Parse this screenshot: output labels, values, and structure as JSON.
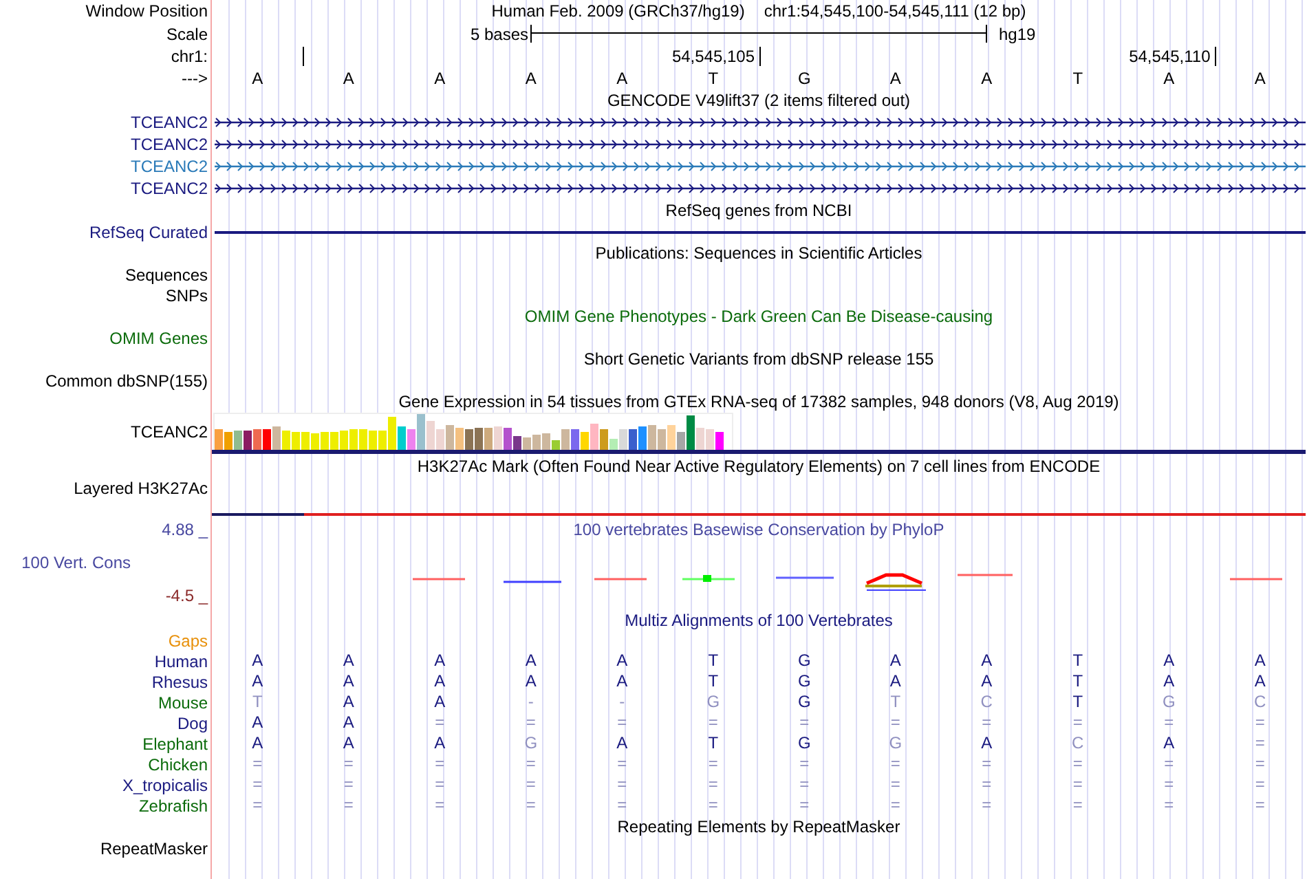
{
  "header": {
    "window_label": "Window Position",
    "assembly": "Human Feb. 2009 (GRCh37/hg19)",
    "position": "chr1:54,545,100-54,545,111 (12 bp)",
    "scale_label": "Scale",
    "scale_text": "5 bases",
    "scale_db": "hg19",
    "chrom_label": "chr1:",
    "ticks": [
      "54,545,105",
      "54,545,110"
    ],
    "strand_label": "--->",
    "bases": [
      "A",
      "A",
      "A",
      "A",
      "A",
      "T",
      "G",
      "A",
      "A",
      "T",
      "A",
      "A"
    ]
  },
  "tracks": [
    {
      "kind": "genes",
      "title": "GENCODE V49lift37 (2 items filtered out)",
      "color": "#000000",
      "items": [
        {
          "label": "TCEANC2",
          "color": "#1a1a80"
        },
        {
          "label": "TCEANC2",
          "color": "#1a1a80"
        },
        {
          "label": "TCEANC2",
          "color": "#2a7ab8"
        },
        {
          "label": "TCEANC2",
          "color": "#1a1a80"
        }
      ]
    },
    {
      "kind": "line",
      "title": "RefSeq genes from NCBI",
      "color": "#000000",
      "labels": [
        {
          "text": "RefSeq Curated",
          "color": "#1a1a80"
        }
      ]
    },
    {
      "kind": "empty",
      "title": "Publications: Sequences in Scientific Articles",
      "color": "#000000",
      "labels": [
        {
          "text": "Sequences",
          "color": "#000000"
        },
        {
          "text": "SNPs",
          "color": "#000000"
        }
      ]
    },
    {
      "kind": "empty",
      "title": "OMIM Gene Phenotypes - Dark Green Can Be Disease-causing",
      "color": "#0b6b0b",
      "labels": [
        {
          "text": "OMIM Genes",
          "color": "#0b6b0b"
        }
      ]
    },
    {
      "kind": "empty",
      "title": "Short Genetic Variants from dbSNP release 155",
      "color": "#000000",
      "labels": [
        {
          "text": "Common dbSNP(155)",
          "color": "#000000"
        }
      ]
    },
    {
      "kind": "expression",
      "title": "Gene Expression in 54 tissues from GTEx RNA-seq of 17382 samples, 948 donors (V8, Aug 2019)",
      "color": "#000000",
      "labels": [
        {
          "text": "TCEANC2",
          "color": "#000000"
        }
      ]
    },
    {
      "kind": "signal",
      "title": "H3K27Ac Mark (Often Found Near Active Regulatory Elements) on 7 cell lines from ENCODE",
      "color": "#000000",
      "labels": [
        {
          "text": "Layered H3K27Ac",
          "color": "#000000"
        }
      ]
    },
    {
      "kind": "conservation",
      "title": "100 vertebrates Basewise Conservation by PhyloP",
      "color": "#4848a0",
      "labels": [
        {
          "text": "4.88 _",
          "color": "#4848a0"
        },
        {
          "text": "100 Vert. Cons",
          "color": "#4848a0"
        },
        {
          "text": "-4.5 _",
          "color": "#8b2a2a"
        }
      ]
    },
    {
      "kind": "alignment",
      "title": "Multiz Alignments of 100 Vertebrates",
      "color": "#1a1a80",
      "labels": [
        {
          "text": "Gaps",
          "color": "#e8900a"
        }
      ],
      "species": [
        {
          "name": "Human",
          "color": "#1a1a80",
          "bases": [
            {
              "base": "A",
              "match": true
            },
            {
              "base": "A",
              "match": true
            },
            {
              "base": "A",
              "match": true
            },
            {
              "base": "A",
              "match": true
            },
            {
              "base": "A",
              "match": true
            },
            {
              "base": "T",
              "match": true
            },
            {
              "base": "G",
              "match": true
            },
            {
              "base": "A",
              "match": true
            },
            {
              "base": "A",
              "match": true
            },
            {
              "base": "T",
              "match": true
            },
            {
              "base": "A",
              "match": true
            },
            {
              "base": "A",
              "match": true
            }
          ]
        },
        {
          "name": "Rhesus",
          "color": "#1a1a80",
          "bases": [
            {
              "base": "A",
              "match": true
            },
            {
              "base": "A",
              "match": true
            },
            {
              "base": "A",
              "match": true
            },
            {
              "base": "A",
              "match": true
            },
            {
              "base": "A",
              "match": true
            },
            {
              "base": "T",
              "match": true
            },
            {
              "base": "G",
              "match": true
            },
            {
              "base": "A",
              "match": true
            },
            {
              "base": "A",
              "match": true
            },
            {
              "base": "T",
              "match": true
            },
            {
              "base": "A",
              "match": true
            },
            {
              "base": "A",
              "match": true
            }
          ]
        },
        {
          "name": "Mouse",
          "color": "#0b6b0b",
          "bases": [
            {
              "base": "T",
              "match": false
            },
            {
              "base": "A",
              "match": true
            },
            {
              "base": "A",
              "match": true
            },
            {
              "base": "-",
              "match": false
            },
            {
              "base": "-",
              "match": false
            },
            {
              "base": "G",
              "match": false
            },
            {
              "base": "G",
              "match": true
            },
            {
              "base": "T",
              "match": false
            },
            {
              "base": "C",
              "match": false
            },
            {
              "base": "T",
              "match": true
            },
            {
              "base": "G",
              "match": false
            },
            {
              "base": "C",
              "match": false
            }
          ]
        },
        {
          "name": "Dog",
          "color": "#1a1a80",
          "bases": [
            {
              "base": "A",
              "match": true
            },
            {
              "base": "A",
              "match": true
            },
            {
              "base": "=",
              "match": false
            },
            {
              "base": "=",
              "match": false
            },
            {
              "base": "=",
              "match": false
            },
            {
              "base": "=",
              "match": false
            },
            {
              "base": "=",
              "match": false
            },
            {
              "base": "=",
              "match": false
            },
            {
              "base": "=",
              "match": false
            },
            {
              "base": "=",
              "match": false
            },
            {
              "base": "=",
              "match": false
            },
            {
              "base": "=",
              "match": false
            }
          ]
        },
        {
          "name": "Elephant",
          "color": "#0b6b0b",
          "bases": [
            {
              "base": "A",
              "match": true
            },
            {
              "base": "A",
              "match": true
            },
            {
              "base": "A",
              "match": true
            },
            {
              "base": "G",
              "match": false
            },
            {
              "base": "A",
              "match": true
            },
            {
              "base": "T",
              "match": true
            },
            {
              "base": "G",
              "match": true
            },
            {
              "base": "G",
              "match": false
            },
            {
              "base": "A",
              "match": true
            },
            {
              "base": "C",
              "match": false
            },
            {
              "base": "A",
              "match": true
            },
            {
              "base": "=",
              "match": false
            }
          ]
        },
        {
          "name": "Chicken",
          "color": "#0b6b0b",
          "bases": [
            {
              "base": "=",
              "match": false
            },
            {
              "base": "=",
              "match": false
            },
            {
              "base": "=",
              "match": false
            },
            {
              "base": "=",
              "match": false
            },
            {
              "base": "=",
              "match": false
            },
            {
              "base": "=",
              "match": false
            },
            {
              "base": "=",
              "match": false
            },
            {
              "base": "=",
              "match": false
            },
            {
              "base": "=",
              "match": false
            },
            {
              "base": "=",
              "match": false
            },
            {
              "base": "=",
              "match": false
            },
            {
              "base": "=",
              "match": false
            }
          ]
        },
        {
          "name": "X_tropicalis",
          "color": "#1a1a80",
          "bases": [
            {
              "base": "=",
              "match": false
            },
            {
              "base": "=",
              "match": false
            },
            {
              "base": "=",
              "match": false
            },
            {
              "base": "=",
              "match": false
            },
            {
              "base": "=",
              "match": false
            },
            {
              "base": "=",
              "match": false
            },
            {
              "base": "=",
              "match": false
            },
            {
              "base": "=",
              "match": false
            },
            {
              "base": "=",
              "match": false
            },
            {
              "base": "=",
              "match": false
            },
            {
              "base": "=",
              "match": false
            },
            {
              "base": "=",
              "match": false
            }
          ]
        },
        {
          "name": "Zebrafish",
          "color": "#0b6b0b",
          "bases": [
            {
              "base": "=",
              "match": false
            },
            {
              "base": "=",
              "match": false
            },
            {
              "base": "=",
              "match": false
            },
            {
              "base": "=",
              "match": false
            },
            {
              "base": "=",
              "match": false
            },
            {
              "base": "=",
              "match": false
            },
            {
              "base": "=",
              "match": false
            },
            {
              "base": "=",
              "match": false
            },
            {
              "base": "=",
              "match": false
            },
            {
              "base": "=",
              "match": false
            },
            {
              "base": "=",
              "match": false
            },
            {
              "base": "=",
              "match": false
            }
          ]
        }
      ]
    },
    {
      "kind": "empty",
      "title": "Repeating Elements by RepeatMasker",
      "color": "#000000",
      "labels": [
        {
          "text": "RepeatMasker",
          "color": "#000000"
        }
      ]
    }
  ]
}
